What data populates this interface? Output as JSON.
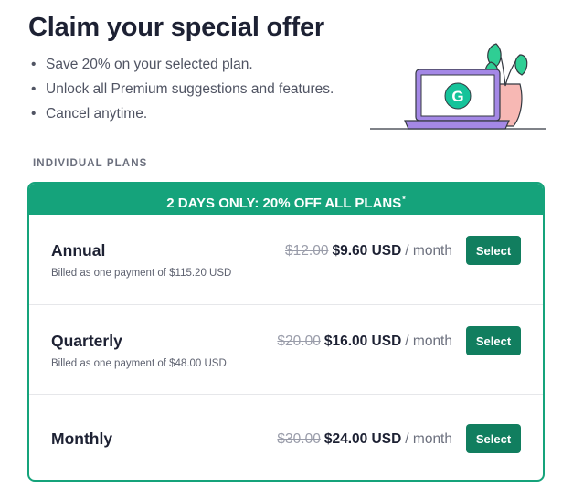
{
  "header": {
    "title": "Claim your special offer",
    "bullet_glyph": "•",
    "bullets": [
      "Save 20% on your selected plan.",
      "Unlock all Premium suggestions and features.",
      "Cancel anytime."
    ]
  },
  "illustration": {
    "icon": "laptop-with-plant-illustration",
    "logo_letter": "G",
    "colors": {
      "laptop": "#a488e6",
      "screen": "#ffffff",
      "logo": "#15c39a",
      "pot": "#f7b8b4",
      "leaves": "#2fce94"
    }
  },
  "section_label": "INDIVIDUAL PLANS",
  "banner": {
    "text": "2 DAYS ONLY: 20% OFF ALL PLANS",
    "mark": "*"
  },
  "plans": [
    {
      "name": "Annual",
      "old_price": "$12.00",
      "new_price": "$9.60 USD",
      "period": "/ month",
      "billing": "Billed as one payment of $115.20 USD",
      "button": "Select"
    },
    {
      "name": "Quarterly",
      "old_price": "$20.00",
      "new_price": "$16.00 USD",
      "period": "/ month",
      "billing": "Billed as one payment of $48.00 USD",
      "button": "Select"
    },
    {
      "name": "Monthly",
      "old_price": "$30.00",
      "new_price": "$24.00 USD",
      "period": "/ month",
      "billing": "",
      "button": "Select"
    }
  ],
  "colors": {
    "brand": "#15a37b",
    "button": "#117e5f",
    "text": "#1d2133",
    "muted": "#6b6f7d"
  }
}
